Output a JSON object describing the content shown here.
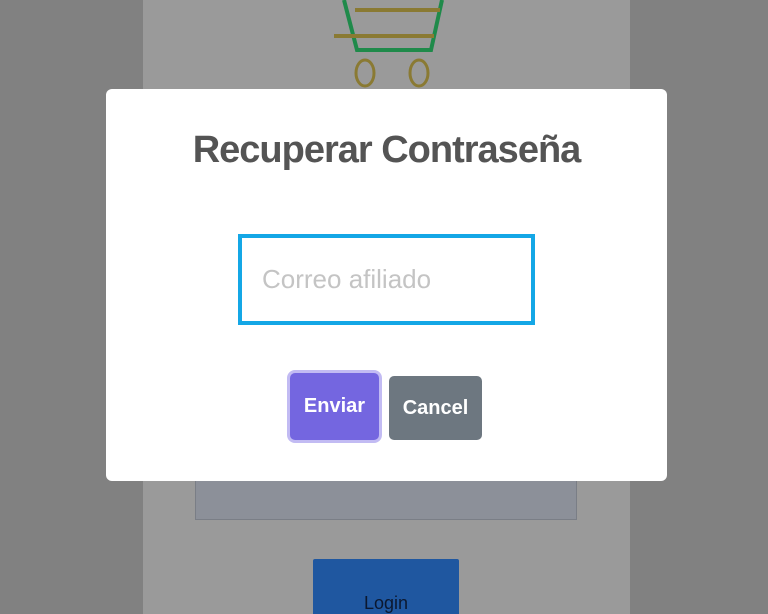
{
  "background": {
    "login_button_label": "Login"
  },
  "modal": {
    "title": "Recuperar Contraseña",
    "email_placeholder": "Correo afiliado",
    "email_value": "",
    "confirm_label": "Enviar",
    "cancel_label": "Cancel"
  },
  "colors": {
    "overlay": "#818181",
    "input_border": "#14a7e6",
    "confirm_button": "#7466e0",
    "cancel_button": "#6d7780",
    "login_button": "#1f57a0"
  },
  "icons": {
    "logo": "shopping-cart-icon"
  }
}
